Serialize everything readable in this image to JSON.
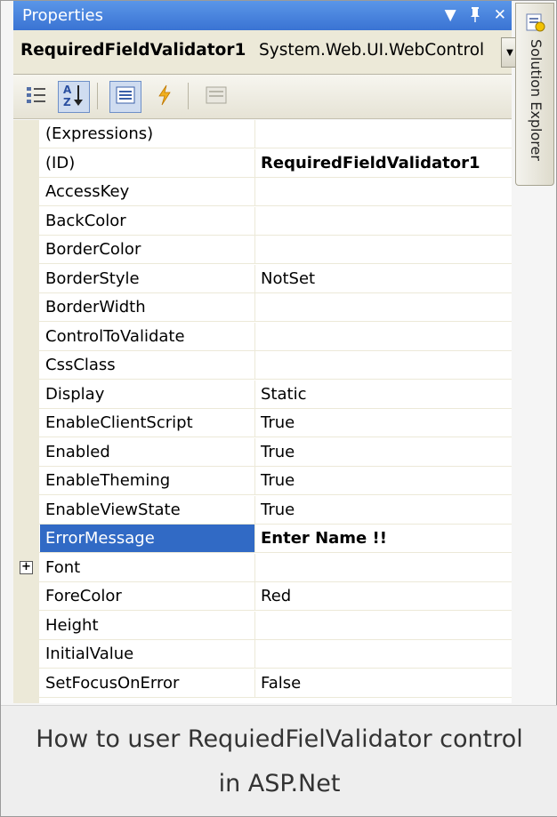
{
  "window": {
    "title": "Properties",
    "selected_object_name": "RequiredFieldValidator1",
    "selected_object_type": "System.Web.UI.WebControls.RequiredFieldValidator"
  },
  "side_panel": {
    "label": "Solution Explorer"
  },
  "properties": [
    {
      "name": "(Expressions)",
      "value": ""
    },
    {
      "name": "(ID)",
      "value": "RequiredFieldValidator1",
      "bold": true
    },
    {
      "name": "AccessKey",
      "value": ""
    },
    {
      "name": "BackColor",
      "value": ""
    },
    {
      "name": "BorderColor",
      "value": ""
    },
    {
      "name": "BorderStyle",
      "value": "NotSet"
    },
    {
      "name": "BorderWidth",
      "value": ""
    },
    {
      "name": "ControlToValidate",
      "value": ""
    },
    {
      "name": "CssClass",
      "value": ""
    },
    {
      "name": "Display",
      "value": "Static"
    },
    {
      "name": "EnableClientScript",
      "value": "True"
    },
    {
      "name": "Enabled",
      "value": "True"
    },
    {
      "name": "EnableTheming",
      "value": "True"
    },
    {
      "name": "EnableViewState",
      "value": "True"
    },
    {
      "name": "ErrorMessage",
      "value": "Enter Name !!",
      "bold": true,
      "selected": true
    },
    {
      "name": "Font",
      "value": "",
      "expandable": true,
      "expander": "+"
    },
    {
      "name": "ForeColor",
      "value": "Red"
    },
    {
      "name": "Height",
      "value": ""
    },
    {
      "name": "InitialValue",
      "value": ""
    },
    {
      "name": "SetFocusOnError",
      "value": "False"
    }
  ],
  "caption": {
    "line1": "How to user RequiedFielValidator control",
    "line2": "in ASP.Net"
  },
  "colors": {
    "title_bar": "#3a73d3",
    "selection": "#316ac5",
    "grid_margin": "#ece9d8"
  },
  "icons": {
    "categorized": "categorized-icon",
    "alphabetical": "alphabetical-icon",
    "properties": "properties-icon",
    "events": "events-icon",
    "property_pages": "property-pages-icon"
  }
}
